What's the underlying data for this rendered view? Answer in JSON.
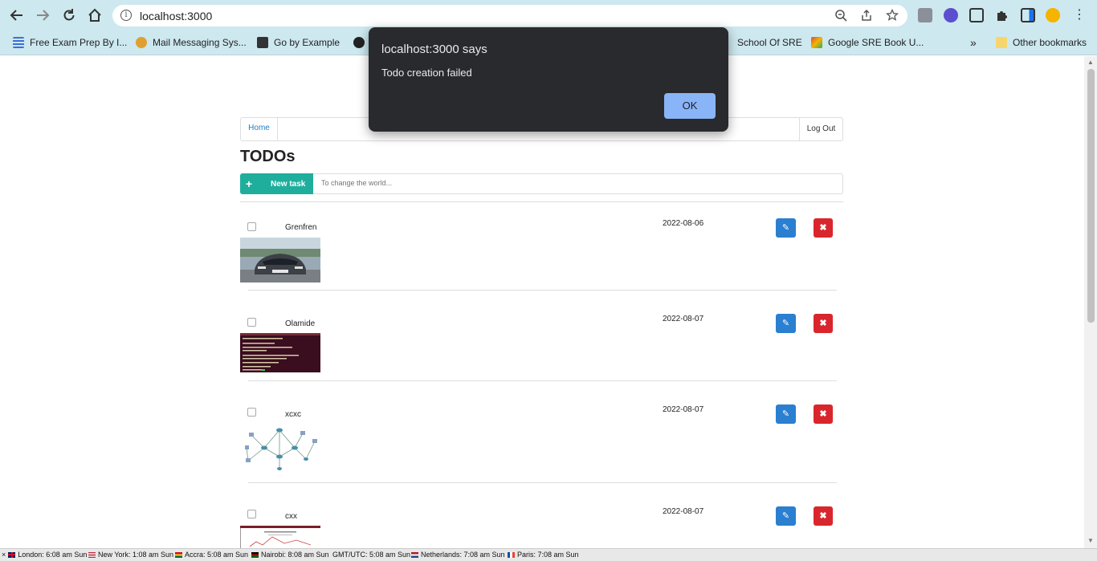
{
  "browser": {
    "url": "localhost:3000",
    "bookmarks": [
      {
        "label": "Free Exam Prep By I...",
        "color": "#3b6fd8"
      },
      {
        "label": "Mail Messaging Sys...",
        "color": "#e0a030"
      },
      {
        "label": "Go by Example",
        "color": "#333333"
      },
      {
        "label": "School Of SRE",
        "color": "#555555"
      },
      {
        "label": "Google SRE Book U...",
        "color": "#d84c3b"
      }
    ],
    "overflow_label": "»",
    "other_bookmarks": "Other bookmarks"
  },
  "navbar": {
    "home": "Home",
    "logout": "Log Out"
  },
  "page": {
    "title": "TODOs",
    "new_task_label": "New task",
    "new_task_icon": "+",
    "new_task_placeholder": "To change the world..."
  },
  "todos": [
    {
      "title": "Grenfren",
      "date": "2022-08-06",
      "thumb": "car-photo"
    },
    {
      "title": "Olamide",
      "date": "2022-08-07",
      "thumb": "terminal-screenshot"
    },
    {
      "title": "xcxc",
      "date": "2022-08-07",
      "thumb": "network-diagram"
    },
    {
      "title": "cxx",
      "date": "2022-08-07",
      "thumb": "document-screenshot"
    }
  ],
  "icons": {
    "edit": "✎",
    "delete": "✖"
  },
  "alert": {
    "title": "localhost:3000 says",
    "message": "Todo creation failed",
    "ok": "OK"
  },
  "statusbar": [
    {
      "label": "London: 6:08 am Sun",
      "flag": "uk"
    },
    {
      "label": "New York: 1:08 am Sun",
      "flag": "us"
    },
    {
      "label": "Accra: 5:08 am Sun",
      "flag": "gh"
    },
    {
      "label": "Nairobi: 8:08 am Sun",
      "flag": "ke"
    },
    {
      "label": "GMT/UTC: 5:08 am Sun",
      "flag": ""
    },
    {
      "label": "Netherlands: 7:08 am Sun",
      "flag": "nl"
    },
    {
      "label": "Paris: 7:08 am Sun",
      "flag": "fr"
    }
  ]
}
